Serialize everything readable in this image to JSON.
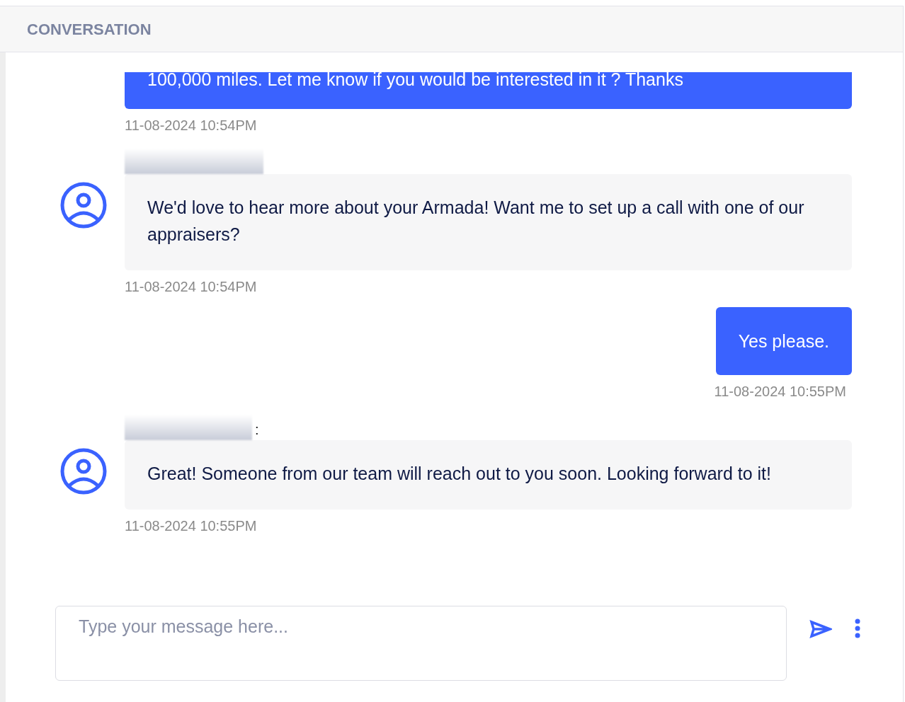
{
  "header": {
    "title": "CONVERSATION"
  },
  "messages": [
    {
      "kind": "outgoing",
      "text": "100,000 miles. Let me know if you would be interested in it ? Thanks",
      "time": "11-08-2024 10:54PM",
      "wide": true
    },
    {
      "kind": "incoming",
      "name_redacted": true,
      "text": "We'd love to hear more about your Armada! Want me to set up a call with one of our appraisers?",
      "time": "11-08-2024 10:54PM"
    },
    {
      "kind": "outgoing",
      "text": "Yes please.",
      "time": "11-08-2024 10:55PM",
      "wide": false
    },
    {
      "kind": "incoming",
      "name_redacted": true,
      "name_suffix": ":",
      "text": "Great! Someone from our team will reach out to you soon. Looking forward to it!",
      "time": "11-08-2024 10:55PM"
    }
  ],
  "composer": {
    "placeholder": "Type your message here..."
  }
}
